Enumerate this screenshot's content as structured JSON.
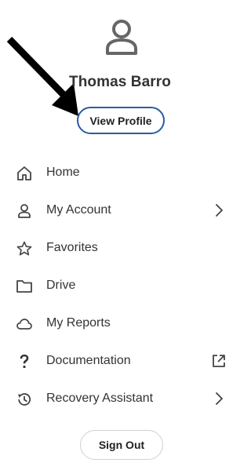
{
  "user": {
    "name": "Thomas Barro",
    "view_profile_label": "View Profile"
  },
  "menu": {
    "items": [
      {
        "label": "Home",
        "icon": "home-icon",
        "trailing": null
      },
      {
        "label": "My Account",
        "icon": "person-icon",
        "trailing": "chevron-right-icon"
      },
      {
        "label": "Favorites",
        "icon": "star-icon",
        "trailing": null
      },
      {
        "label": "Drive",
        "icon": "folder-icon",
        "trailing": null
      },
      {
        "label": "My Reports",
        "icon": "cloud-icon",
        "trailing": null
      },
      {
        "label": "Documentation",
        "icon": "question-mark-icon",
        "trailing": "external-link-icon"
      },
      {
        "label": "Recovery Assistant",
        "icon": "history-icon",
        "trailing": "chevron-right-icon"
      }
    ]
  },
  "sign_out_label": "Sign Out",
  "colors": {
    "accent_border": "#2a5aa6",
    "text": "#333333",
    "icon": "#444444",
    "arrow": "#000000"
  }
}
